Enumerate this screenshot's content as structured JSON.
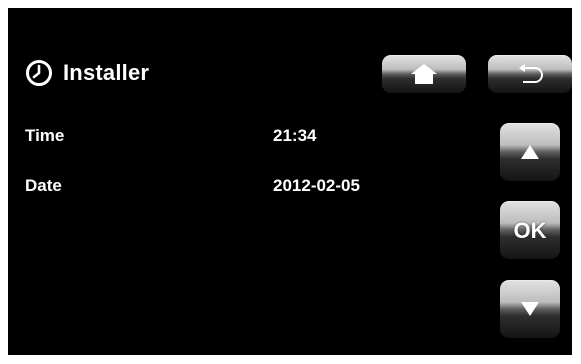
{
  "header": {
    "title": "Installer",
    "icon": "clock-icon"
  },
  "nav": {
    "home_icon": "home-icon",
    "back_icon": "back-arrow-icon"
  },
  "settings": [
    {
      "label": "Time",
      "value": "21:34"
    },
    {
      "label": "Date",
      "value": "2012-02-05"
    }
  ],
  "controls": {
    "up_icon": "arrow-up-icon",
    "ok_label": "OK",
    "down_icon": "arrow-down-icon"
  },
  "colors": {
    "background": "#000000",
    "text": "#ffffff",
    "button_highlight": "#e2e2e2",
    "button_shadow": "#141414"
  }
}
